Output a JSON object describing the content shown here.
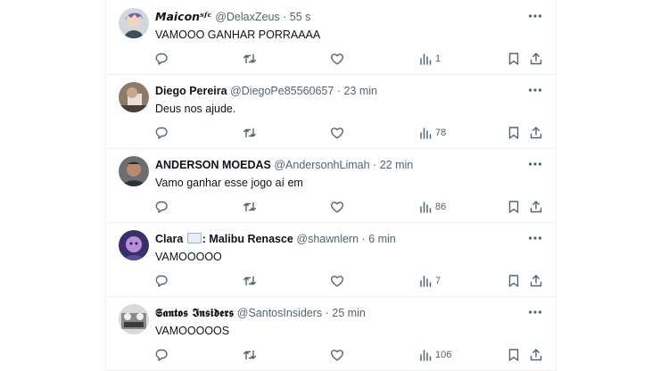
{
  "posts": [
    {
      "name": "𝙈𝙖𝙞𝙘𝙤𝙣ˢᶠᶜ",
      "handle": "@DelaxZeus",
      "dot": "·",
      "time": "55 s",
      "text": "VAMOOO GANHAR PORRAAAA",
      "views": "1"
    },
    {
      "name": "Diego Pereira",
      "handle": "@DiegoPe85560657",
      "dot": "·",
      "time": "23 min",
      "text": "Deus nos ajude.",
      "views": "78"
    },
    {
      "name": "ANDERSON MOEDAS",
      "handle": "@AndersonhLimah",
      "dot": "·",
      "time": "22 min",
      "text": "Vamo ganhar esse jogo aí em",
      "views": "86"
    },
    {
      "name_before_emoji": "Clara",
      "name_after_emoji": ": Malibu Renasce",
      "handle": "@shawnlern",
      "dot": "·",
      "time": "6 min",
      "text": "VAMOOOOO",
      "views": "7"
    },
    {
      "name": "𝕾𝖆𝖓𝖙𝖔𝖘 𝕴𝖓𝖘𝖎𝖉𝖊𝖗𝖘",
      "handle": "@SantosInsiders",
      "dot": "·",
      "time": "25 min",
      "text": "VAMOOOOOS",
      "views": "106"
    }
  ],
  "icons": {
    "more": "more-horizontal-icon",
    "reply": "reply-icon",
    "repost": "repost-icon",
    "like": "heart-icon",
    "views": "views-chart-icon",
    "bookmark": "bookmark-icon",
    "share": "share-icon"
  },
  "colors": {
    "text": "#0f1419",
    "secondary": "#536471",
    "divider": "#eff3f4"
  }
}
